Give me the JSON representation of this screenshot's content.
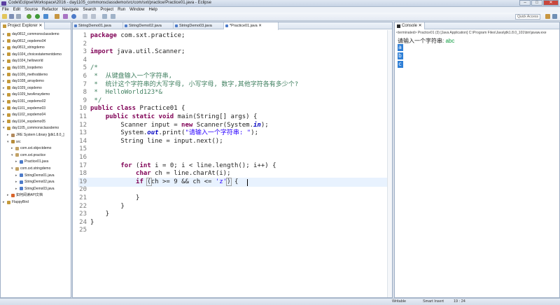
{
  "window": {
    "title": "Code\\Eclipse\\Workspace\\2016 - day1105_commonsclassdemo/src/com/sxt/practice/Practice01.java - Eclipse",
    "minimize": "–",
    "maximize": "□",
    "close": "✕"
  },
  "menu": [
    "File",
    "Edit",
    "Source",
    "Refactor",
    "Navigate",
    "Search",
    "Project",
    "Run",
    "Window",
    "Help"
  ],
  "toolbar": {
    "quick_access": "Quick Access"
  },
  "explorer": {
    "tab_label": "Project Explorer ✕",
    "items": [
      {
        "label": "day0812_commonsclassdemo",
        "depth": 0,
        "icon": "project"
      },
      {
        "label": "day0812_oopdemo04",
        "depth": 0,
        "icon": "project"
      },
      {
        "label": "day0813_stringdemo",
        "depth": 0,
        "icon": "project"
      },
      {
        "label": "day1024_choicestatementdemo",
        "depth": 0,
        "icon": "project"
      },
      {
        "label": "day1024_helloworld",
        "depth": 0,
        "icon": "project"
      },
      {
        "label": "day1025_loopdemo",
        "depth": 0,
        "icon": "project"
      },
      {
        "label": "day1026_methoddemo",
        "depth": 0,
        "icon": "project"
      },
      {
        "label": "day1028_arraydemo",
        "depth": 0,
        "icon": "project"
      },
      {
        "label": "day1029_oopdemo",
        "depth": 0,
        "icon": "project"
      },
      {
        "label": "day1029_twoArraydemo",
        "depth": 0,
        "icon": "project"
      },
      {
        "label": "day1031_oopdemo02",
        "depth": 0,
        "icon": "project"
      },
      {
        "label": "day1101_oopdemo03",
        "depth": 0,
        "icon": "project"
      },
      {
        "label": "day1102_oopdemo04",
        "depth": 0,
        "icon": "project"
      },
      {
        "label": "day1104_oopdemo05",
        "depth": 0,
        "icon": "project"
      },
      {
        "label": "day1105_commonsclassdemo",
        "depth": 0,
        "icon": "project",
        "expanded": true
      },
      {
        "label": "JRE System Library [jdk1.8.0_]",
        "depth": 1,
        "icon": "library"
      },
      {
        "label": "src",
        "depth": 1,
        "icon": "src",
        "expanded": true
      },
      {
        "label": "com.sxt.objectdemo",
        "depth": 2,
        "icon": "package"
      },
      {
        "label": "com.sxt.practice",
        "depth": 2,
        "icon": "package",
        "expanded": true
      },
      {
        "label": "Practice01.java",
        "depth": 3,
        "icon": "java"
      },
      {
        "label": "com.sxt.stringdemo",
        "depth": 2,
        "icon": "package",
        "expanded": true
      },
      {
        "label": "StringDemo01.java",
        "depth": 3,
        "icon": "java"
      },
      {
        "label": "StringDemo02.java",
        "depth": 3,
        "icon": "java"
      },
      {
        "label": "StringDemo03.java",
        "depth": 3,
        "icon": "java"
      },
      {
        "label": "如何阅读API文档",
        "depth": 1,
        "icon": "html"
      },
      {
        "label": "FlappyBird",
        "depth": 0,
        "icon": "project"
      }
    ]
  },
  "editor": {
    "tabs": [
      {
        "label": "StringDemo01.java",
        "active": false
      },
      {
        "label": "StringDemo02.java",
        "active": false
      },
      {
        "label": "StringDemo03.java",
        "active": false
      },
      {
        "label": "*Practice01.java ✕",
        "active": true
      }
    ],
    "lines": [
      {
        "n": "1",
        "html": "<span class=\"kw\">package</span> com.sxt.practice;"
      },
      {
        "n": "2",
        "html": ""
      },
      {
        "n": "3",
        "html": "<span class=\"kw\">import</span> java.util.Scanner;"
      },
      {
        "n": "4",
        "html": ""
      },
      {
        "n": "5",
        "html": "<span class=\"cm\">/*</span>"
      },
      {
        "n": "6",
        "html": "<span class=\"cm\"> *  从键盘输入一个字符串,</span>"
      },
      {
        "n": "7",
        "html": "<span class=\"cm\"> *  统计这个字符串的大写字母, 小写字母, 数字,其他字符各有多少个?</span>"
      },
      {
        "n": "8",
        "html": "<span class=\"cm\"> *  HelloWorld123*&amp;</span>"
      },
      {
        "n": "9",
        "html": "<span class=\"cm\"> */</span>"
      },
      {
        "n": "10",
        "html": "<span class=\"kw\">public class</span> Practice01 {"
      },
      {
        "n": "11",
        "html": "    <span class=\"kw\">public static void</span> main(String[] args) {"
      },
      {
        "n": "12",
        "html": "        Scanner input = <span class=\"kw\">new</span> Scanner(System.<span class=\"fld\">in</span>);"
      },
      {
        "n": "13",
        "html": "        System.<span class=\"fld\">out</span>.print(<span class=\"str\">\"请输入一个字符串: \"</span>);"
      },
      {
        "n": "14",
        "html": "        String line = input.next();"
      },
      {
        "n": "15",
        "html": ""
      },
      {
        "n": "16",
        "html": ""
      },
      {
        "n": "17",
        "html": "        <span class=\"kw\">for</span> (<span class=\"kw\">int</span> i = 0; i &lt; line.length(); i++) {"
      },
      {
        "n": "18",
        "html": "            <span class=\"kw\">char</span> ch = line.charAt(i);"
      },
      {
        "n": "19",
        "html": "            <span class=\"kw\">if</span> <span class=\"brk\">(</span>ch &gt;= 9 &amp;&amp; ch &lt;= <span class=\"str\">'z'</span><span class=\"brk\">)</span> {"
      },
      {
        "n": "20",
        "html": ""
      },
      {
        "n": "21",
        "html": "            }"
      },
      {
        "n": "22",
        "html": "        }"
      },
      {
        "n": "23",
        "html": "    }"
      },
      {
        "n": "24",
        "html": "}"
      },
      {
        "n": "25",
        "html": ""
      }
    ]
  },
  "console": {
    "tab_label": "Console ✕",
    "launch_info": "<terminated> Practice01 (3) [Java Application] C:\\Program Files\\Java\\jdk1.8.0_101\\bin\\javaw.exe",
    "prompt": "请输入一个字符串: ",
    "input": "abc",
    "output": [
      "a",
      "b",
      "c"
    ]
  },
  "status": {
    "mode": "Writable",
    "insert": "Smart Insert",
    "position": "19 : 24"
  }
}
